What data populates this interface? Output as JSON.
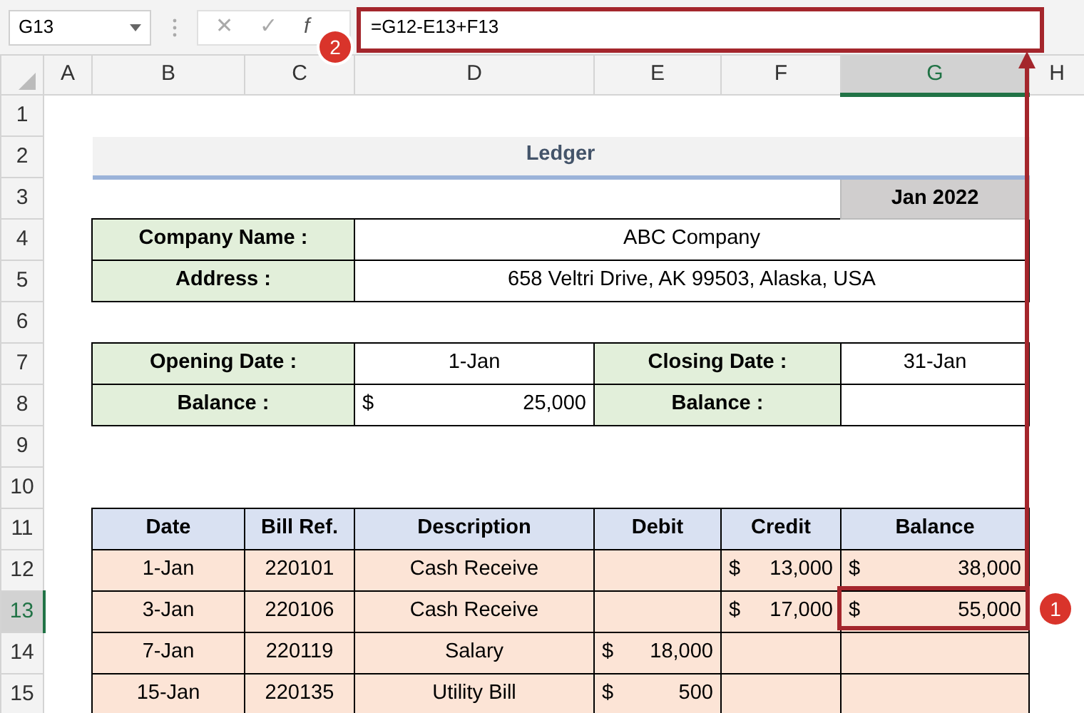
{
  "formula_bar": {
    "name_box": "G13",
    "cancel": "✕",
    "enter": "✓",
    "function": "f",
    "formula": "=G12-E13+F13"
  },
  "columns": [
    {
      "label": "A",
      "selected": false
    },
    {
      "label": "B",
      "selected": false
    },
    {
      "label": "C",
      "selected": false
    },
    {
      "label": "D",
      "selected": false
    },
    {
      "label": "E",
      "selected": false
    },
    {
      "label": "F",
      "selected": false
    },
    {
      "label": "G",
      "selected": true
    },
    {
      "label": "H",
      "selected": false
    }
  ],
  "rows": [
    {
      "label": "1",
      "selected": false,
      "cells": [
        {
          "kind": "blank"
        },
        {
          "kind": "blank"
        },
        {
          "kind": "blank"
        },
        {
          "kind": "blank"
        },
        {
          "kind": "blank"
        },
        {
          "kind": "blank"
        },
        {
          "kind": "blank"
        },
        {
          "kind": "blank"
        }
      ]
    },
    {
      "label": "2",
      "selected": false,
      "cells": [
        {
          "kind": "blank"
        },
        {
          "kind": "title",
          "text": "Ledger"
        },
        {
          "kind": "merged"
        },
        {
          "kind": "merged"
        },
        {
          "kind": "merged"
        },
        {
          "kind": "merged"
        },
        {
          "kind": "merged"
        },
        {
          "kind": "blank"
        }
      ]
    },
    {
      "label": "3",
      "selected": false,
      "cells": [
        {
          "kind": "blank"
        },
        {
          "kind": "blank"
        },
        {
          "kind": "blank"
        },
        {
          "kind": "blank"
        },
        {
          "kind": "blank"
        },
        {
          "kind": "blank"
        },
        {
          "kind": "month",
          "text": "Jan 2022"
        },
        {
          "kind": "blank"
        }
      ]
    },
    {
      "label": "4",
      "selected": false,
      "cells": [
        {
          "kind": "blank"
        },
        {
          "kind": "label",
          "text": "Company Name :"
        },
        {
          "kind": "merged"
        },
        {
          "kind": "value",
          "text": "ABC Company"
        },
        {
          "kind": "merged"
        },
        {
          "kind": "merged"
        },
        {
          "kind": "merged"
        },
        {
          "kind": "blank"
        }
      ]
    },
    {
      "label": "5",
      "selected": false,
      "cells": [
        {
          "kind": "blank"
        },
        {
          "kind": "label",
          "text": "Address :"
        },
        {
          "kind": "merged"
        },
        {
          "kind": "value",
          "text": "658 Veltri Drive, AK 99503, Alaska, USA"
        },
        {
          "kind": "merged"
        },
        {
          "kind": "merged"
        },
        {
          "kind": "merged"
        },
        {
          "kind": "blank"
        }
      ]
    },
    {
      "label": "6",
      "selected": false,
      "cells": [
        {
          "kind": "blank"
        },
        {
          "kind": "blank"
        },
        {
          "kind": "blank"
        },
        {
          "kind": "blank"
        },
        {
          "kind": "blank"
        },
        {
          "kind": "blank"
        },
        {
          "kind": "blank"
        },
        {
          "kind": "blank"
        }
      ]
    },
    {
      "label": "7",
      "selected": false,
      "cells": [
        {
          "kind": "blank"
        },
        {
          "kind": "label",
          "text": "Opening Date :"
        },
        {
          "kind": "merged"
        },
        {
          "kind": "value",
          "text": "1-Jan"
        },
        {
          "kind": "label",
          "text": "Closing Date :"
        },
        {
          "kind": "merged"
        },
        {
          "kind": "value",
          "text": "31-Jan"
        },
        {
          "kind": "blank"
        }
      ]
    },
    {
      "label": "8",
      "selected": false,
      "cells": [
        {
          "kind": "blank"
        },
        {
          "kind": "label",
          "text": "Balance :"
        },
        {
          "kind": "merged"
        },
        {
          "kind": "value",
          "symbol": "$",
          "amount": "25,000"
        },
        {
          "kind": "label",
          "text": "Balance :"
        },
        {
          "kind": "merged"
        },
        {
          "kind": "value"
        },
        {
          "kind": "blank"
        }
      ]
    },
    {
      "label": "9",
      "selected": false,
      "cells": [
        {
          "kind": "blank"
        },
        {
          "kind": "blank"
        },
        {
          "kind": "blank"
        },
        {
          "kind": "blank"
        },
        {
          "kind": "blank"
        },
        {
          "kind": "blank"
        },
        {
          "kind": "blank"
        },
        {
          "kind": "blank"
        }
      ]
    },
    {
      "label": "10",
      "selected": false,
      "cells": [
        {
          "kind": "blank"
        },
        {
          "kind": "blank"
        },
        {
          "kind": "blank"
        },
        {
          "kind": "blank"
        },
        {
          "kind": "blank"
        },
        {
          "kind": "blank"
        },
        {
          "kind": "blank"
        },
        {
          "kind": "blank"
        }
      ]
    },
    {
      "label": "11",
      "selected": false,
      "cells": [
        {
          "kind": "blank"
        },
        {
          "kind": "header",
          "text": "Date"
        },
        {
          "kind": "header",
          "text": "Bill Ref."
        },
        {
          "kind": "header",
          "text": "Description"
        },
        {
          "kind": "header",
          "text": "Debit"
        },
        {
          "kind": "header",
          "text": "Credit"
        },
        {
          "kind": "header",
          "text": "Balance"
        },
        {
          "kind": "blank"
        }
      ]
    },
    {
      "label": "12",
      "selected": false,
      "cells": [
        {
          "kind": "blank"
        },
        {
          "kind": "entry",
          "text": "1-Jan"
        },
        {
          "kind": "entry",
          "text": "220101"
        },
        {
          "kind": "entry",
          "text": "Cash Receive"
        },
        {
          "kind": "entry"
        },
        {
          "kind": "entry",
          "symbol": "$",
          "amount": "13,000"
        },
        {
          "kind": "entry",
          "symbol": "$",
          "amount": "38,000"
        },
        {
          "kind": "blank"
        }
      ]
    },
    {
      "label": "13",
      "selected": true,
      "cells": [
        {
          "kind": "blank"
        },
        {
          "kind": "entry",
          "text": "3-Jan"
        },
        {
          "kind": "entry",
          "text": "220106"
        },
        {
          "kind": "entry",
          "text": "Cash Receive"
        },
        {
          "kind": "entry"
        },
        {
          "kind": "entry",
          "symbol": "$",
          "amount": "17,000"
        },
        {
          "kind": "entry",
          "symbol": "$",
          "amount": "55,000"
        },
        {
          "kind": "blank"
        }
      ]
    },
    {
      "label": "14",
      "selected": false,
      "cells": [
        {
          "kind": "blank"
        },
        {
          "kind": "entry",
          "text": "7-Jan"
        },
        {
          "kind": "entry",
          "text": "220119"
        },
        {
          "kind": "entry",
          "text": "Salary"
        },
        {
          "kind": "entry",
          "symbol": "$",
          "amount": "18,000"
        },
        {
          "kind": "entry"
        },
        {
          "kind": "entry"
        },
        {
          "kind": "blank"
        }
      ]
    },
    {
      "label": "15",
      "selected": false,
      "cells": [
        {
          "kind": "blank"
        },
        {
          "kind": "entry",
          "text": "15-Jan"
        },
        {
          "kind": "entry",
          "text": "220135"
        },
        {
          "kind": "entry",
          "text": "Utility Bill"
        },
        {
          "kind": "entry",
          "symbol": "$",
          "amount": "500"
        },
        {
          "kind": "entry"
        },
        {
          "kind": "entry"
        },
        {
          "kind": "blank"
        }
      ]
    }
  ],
  "annotations": [
    {
      "label": "1"
    },
    {
      "label": "2"
    }
  ]
}
